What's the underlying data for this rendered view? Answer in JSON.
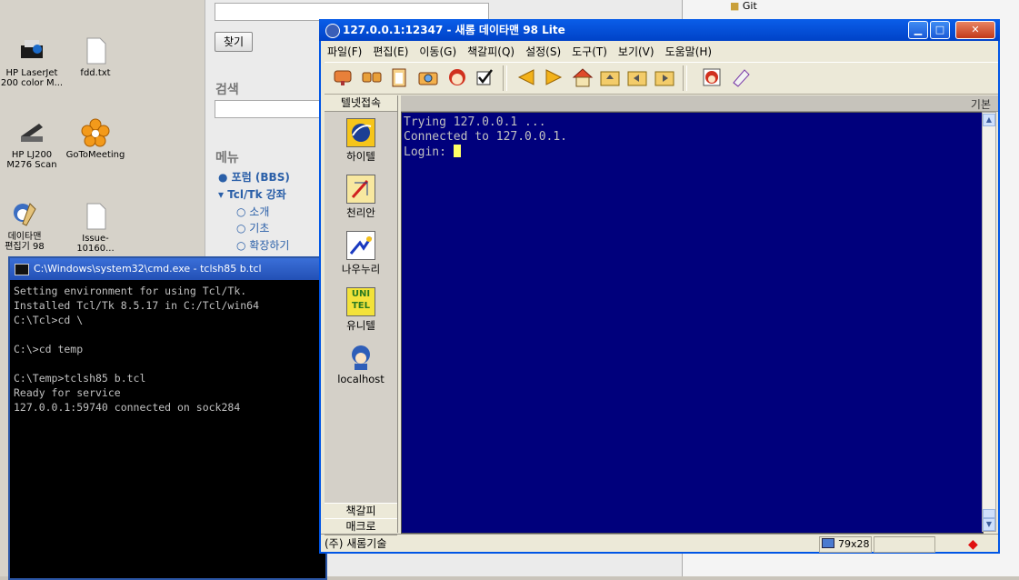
{
  "desktop": {
    "icons": [
      {
        "label": "HP LaserJet\n200 color M...",
        "icon": "printer-icon"
      },
      {
        "label": "fdd.txt",
        "icon": "text-file-icon"
      },
      {
        "label": "HP LJ200\nM276 Scan",
        "icon": "scanner-icon"
      },
      {
        "label": "GoToMeeting",
        "icon": "gotomeeting-icon"
      },
      {
        "label": "데이타맨\n편집기 98",
        "icon": "datamen-editor-icon"
      },
      {
        "label": "Issue-10160...",
        "icon": "text-file-icon"
      }
    ]
  },
  "web": {
    "find_button": "찾기",
    "search_heading": "검색",
    "menu_heading": "메뉴",
    "menu_items": [
      "포럼 (BBS)",
      "Tcl/Tk 강좌",
      "소개",
      "기초",
      "확장하기"
    ]
  },
  "right_pane": {
    "item": "Git"
  },
  "cmd": {
    "title": "C:\\Windows\\system32\\cmd.exe - tclsh85  b.tcl",
    "lines": "Setting environment for using Tcl/Tk.\nInstalled Tcl/Tk 8.5.17 in C:/Tcl/win64\nC:\\Tcl>cd \\\n\nC:\\>cd temp\n\nC:\\Temp>tclsh85 b.tcl\nReady for service\n127.0.0.1:59740 connected on sock284"
  },
  "main": {
    "title": "127.0.0.1:12347 - 새롬 데이타맨 98 Lite",
    "menu": [
      "파일(F)",
      "편집(E)",
      "이동(G)",
      "책갈피(Q)",
      "설정(S)",
      "도구(T)",
      "보기(V)",
      "도움말(H)"
    ],
    "sidebar_header": "텔넷접속",
    "sidebar_items": [
      "하이텔",
      "천리안",
      "나우누리",
      "유니텔",
      "localhost"
    ],
    "sidebar_bottom": [
      "책갈피",
      "매크로"
    ],
    "tab_label": "기본",
    "terminal_text": "Trying 127.0.0.1 ...\nConnected to 127.0.0.1.\nLogin: ",
    "status": {
      "left": "(주) 새롬기술",
      "size": "79x28"
    }
  },
  "colors": {
    "terminal_bg": "#00007c",
    "titlebar": "#0a5ee9",
    "cursor": "#ffff66"
  }
}
